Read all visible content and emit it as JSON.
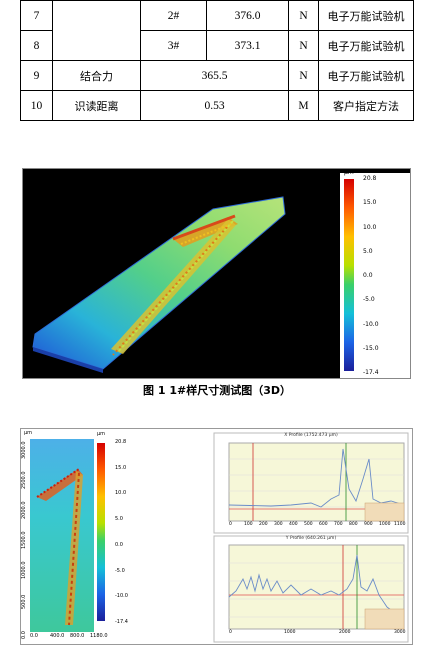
{
  "table": {
    "rows": [
      {
        "no": "7",
        "item": "",
        "sub": "2#",
        "value": "376.0",
        "unit": "N",
        "method": "电子万能试验机"
      },
      {
        "no": "8",
        "item": "",
        "sub": "3#",
        "value": "373.1",
        "unit": "N",
        "method": "电子万能试验机"
      },
      {
        "no": "9",
        "item": "结合力",
        "value": "365.5",
        "unit": "N",
        "method": "电子万能试验机"
      },
      {
        "no": "10",
        "item": "识读距离",
        "value": "0.53",
        "unit": "M",
        "method": "客户指定方法"
      }
    ]
  },
  "figure1": {
    "unit": "μm",
    "colorbar_ticks": [
      "20.8",
      "15.0",
      "10.0",
      "5.0",
      "0.0",
      "-5.0",
      "-10.0",
      "-15.0",
      "-17.4"
    ]
  },
  "caption": "图 1 1#样尺寸测试图（3D）",
  "figure2": {
    "left_unit_y": "μm",
    "left_unit_x": "μm",
    "left_y_ticks": [
      "3000.0",
      "2500.0",
      "2000.0",
      "1500.0",
      "1000.0",
      "500.0",
      "0.0"
    ],
    "left_x_ticks": [
      "0.0",
      "400.0",
      "800.0",
      "1180.0"
    ],
    "colorbar_unit": "μm",
    "colorbar_ticks": [
      "20.8",
      "15.0",
      "10.0",
      "5.0",
      "0.0",
      "-5.0",
      "-10.0",
      "-17.4"
    ],
    "x_profile_title": "X Profile (1752.473 μm)",
    "y_profile_title": "Y Profile (640.261 μm)",
    "x_profile_x_ticks": [
      "0",
      "100",
      "200",
      "300",
      "400",
      "500",
      "600",
      "700",
      "800",
      "900",
      "1000",
      "1100"
    ],
    "y_profile_x_ticks": [
      "0",
      "1000",
      "2000",
      "3000"
    ],
    "axis_unit": "μm"
  }
}
